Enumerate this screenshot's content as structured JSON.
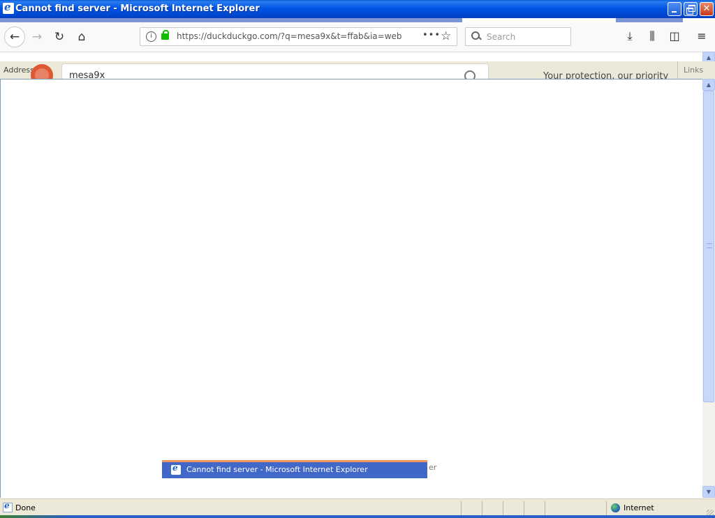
{
  "window": {
    "title": "Cannot find server - Microsoft Internet Explorer"
  },
  "firefox_ghost": {
    "url": "https://duckduckgo.com/?q=mesa9x&t=ffab&ia=web",
    "more": "•••",
    "search_placeholder": "Search",
    "search_query": "mesa9x",
    "privacy_text": "Your protection, our priority"
  },
  "address_bar": {
    "label": "Address",
    "links_label": "Links"
  },
  "taskbar_ghost": {
    "text": "Cannot find server - Microsoft Internet Explorer",
    "tail": "er"
  },
  "status_bar": {
    "text": "Done",
    "zone": "Internet"
  },
  "icons": {
    "back": "back-arrow-icon",
    "forward": "forward-arrow-icon",
    "reload": "reload-icon",
    "home": "home-icon",
    "info": "info-icon",
    "lock": "lock-icon",
    "star": "bookmark-star-icon",
    "search": "search-icon",
    "download": "download-icon",
    "library": "library-icon",
    "sidebar": "sidebar-icon",
    "menu": "hamburger-menu-icon"
  },
  "colors": {
    "titlebar": "#0055e5",
    "chrome": "#ece9d8",
    "ddg_orange": "#de5833",
    "lock_green": "#12bc00"
  }
}
